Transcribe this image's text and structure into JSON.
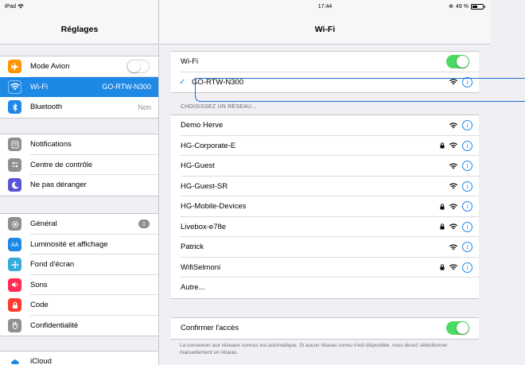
{
  "status_bar": {
    "device": "iPad",
    "time": "17:44",
    "battery": "49 %"
  },
  "sidebar": {
    "title": "Réglages",
    "groups": [
      [
        {
          "label": "Mode Avion",
          "icon": "airplane-icon",
          "color": "#ff9500",
          "control": "toggle-off"
        },
        {
          "label": "Wi-Fi",
          "icon": "wifi-icon",
          "color": "#1e88e5",
          "value": "GO-RTW-N300",
          "selected": true
        },
        {
          "label": "Bluetooth",
          "icon": "bluetooth-icon",
          "color": "#1e88e5",
          "value": "Non"
        }
      ],
      [
        {
          "label": "Notifications",
          "icon": "notifications-icon",
          "color": "#8e8e93"
        },
        {
          "label": "Centre de contrôle",
          "icon": "control-center-icon",
          "color": "#8e8e93"
        },
        {
          "label": "Ne pas déranger",
          "icon": "moon-icon",
          "color": "#5856d6"
        }
      ],
      [
        {
          "label": "Général",
          "icon": "gear-icon",
          "color": "#8e8e93",
          "badge": "1"
        },
        {
          "label": "Luminosité et affichage",
          "icon": "brightness-icon",
          "color": "#1e88e5"
        },
        {
          "label": "Fond d'écran",
          "icon": "wallpaper-icon",
          "color": "#34aadc"
        },
        {
          "label": "Sons",
          "icon": "speaker-icon",
          "color": "#ff2d55"
        },
        {
          "label": "Code",
          "icon": "lock-icon",
          "color": "#ff3b30"
        },
        {
          "label": "Confidentialité",
          "icon": "hand-icon",
          "color": "#8e8e93"
        }
      ],
      [
        {
          "label": "iCloud",
          "icon": "cloud-icon",
          "color": "#1e88e5"
        }
      ]
    ]
  },
  "wifi": {
    "title": "Wi-Fi",
    "toggle_label": "Wi-Fi",
    "toggle_on": true,
    "connected_network": "GO-RTW-N300",
    "choose_network_label": "CHOISISSEZ UN RÉSEAU...",
    "networks": [
      {
        "name": "Demo Herve",
        "locked": false
      },
      {
        "name": "HG-Corporate-E",
        "locked": true
      },
      {
        "name": "HG-Guest",
        "locked": false
      },
      {
        "name": "HG-Guest-SR",
        "locked": false
      },
      {
        "name": "HG-Mobile-Devices",
        "locked": true
      },
      {
        "name": "Livebox-e78e",
        "locked": true
      },
      {
        "name": "Patrick",
        "locked": false
      },
      {
        "name": "WifiSelmoni",
        "locked": true
      }
    ],
    "other_label": "Autre...",
    "ask_join_label": "Confirmer l'accès",
    "ask_join_on": true,
    "footnote": "La connexion aux réseaux connus est automatique. Si aucun réseau connu n'est disponible, vous devez sélectionner manuellement un réseau."
  },
  "colors": {
    "accent": "#1e88e5",
    "toggle_on": "#4cd964",
    "callout": "#1a6fd6"
  }
}
